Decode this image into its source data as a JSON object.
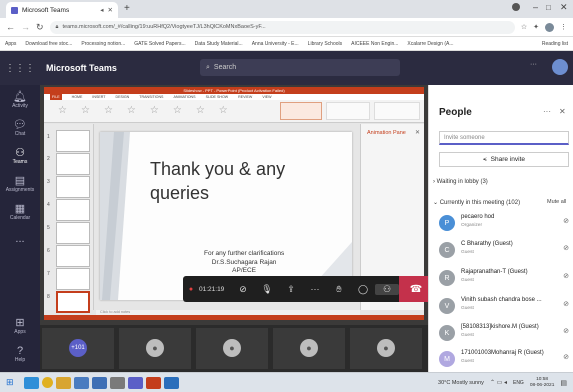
{
  "browser": {
    "tab_title": "Microsoft Teams",
    "new_tab_icon": "+",
    "url": "teams.microsoft.com/_#/calling/19:uuRHfQ2/ViogtyeeTJ/L3hQlCKoMNxBaoeS-yF...",
    "bookmarks": [
      "Apps",
      "Download free stoc...",
      "Processing notion...",
      "GATE Solved Papers...",
      "Data Study Material...",
      "Anna University - E...",
      "Library Schools",
      "AICEEE Non Engin...",
      "Xcalarre Design (A..."
    ],
    "reading_list": "Reading list"
  },
  "teams": {
    "app_title": "Microsoft Teams",
    "search_placeholder": "Search"
  },
  "rail": [
    {
      "label": "Activity",
      "icon": "bell-icon"
    },
    {
      "label": "Chat",
      "icon": "chat-icon"
    },
    {
      "label": "Teams",
      "icon": "teams-icon"
    },
    {
      "label": "Assignments",
      "icon": "assignments-icon"
    },
    {
      "label": "Calendar",
      "icon": "calendar-icon"
    },
    {
      "label": "...",
      "icon": "more-icon"
    },
    {
      "label": "Apps",
      "icon": "apps-icon"
    },
    {
      "label": "Help",
      "icon": "help-icon"
    }
  ],
  "ppt": {
    "title": "Slideshow - PPT - PowerPoint (Product Activation Failed)",
    "tabs": [
      "FILE",
      "HOME",
      "INSERT",
      "DESIGN",
      "TRANSITIONS",
      "ANIMATIONS",
      "SLIDE SHOW",
      "REVIEW",
      "VIEW"
    ],
    "anim_pane_label": "Animation Pane",
    "slide_numbers": [
      "1",
      "2",
      "3",
      "4",
      "5",
      "6",
      "7",
      "8"
    ],
    "notes_placeholder": "Click to add notes"
  },
  "slide": {
    "title_line1": "Thank you & any",
    "title_line2": "queries",
    "footer_line1": "For any further clarifications",
    "footer_line2": "Dr.S.Suchagara Rajan",
    "footer_line3": "AP/ECE"
  },
  "callbar": {
    "timer": "01:21:19"
  },
  "tiles": {
    "overflow": "+101"
  },
  "people": {
    "title": "People",
    "invite_placeholder": "Invite someone",
    "share_invite": "Share invite",
    "lobby": "Waiting in lobby (3)",
    "meeting": "Currently in this meeting (102)",
    "mute_all": "Mute all",
    "participants": [
      {
        "name": "pecaero hod",
        "role": "Organizer",
        "initial": "P"
      },
      {
        "name": "C Bharathy (Guest)",
        "role": "Guest",
        "initial": "C"
      },
      {
        "name": "Rajapranathan-T (Guest)",
        "role": "Guest",
        "initial": "R"
      },
      {
        "name": "Vinith subash chandra bose ...",
        "role": "Guest",
        "initial": "V"
      },
      {
        "name": "[58108313]kishore.M (Guest)",
        "role": "Guest",
        "initial": "K"
      },
      {
        "name": "171001003Mohanraj R (Guest)",
        "role": "Guest",
        "initial": "M"
      }
    ]
  },
  "taskbar": {
    "weather": "30°C Mostly sunny",
    "lang": "ENG",
    "time": "10:58",
    "date": "08-06-2021"
  },
  "colors": {
    "teams_bar": "#2b2b40",
    "rail": "#25253a",
    "ppt_accent": "#c43e1c",
    "end_call": "#c4314b"
  }
}
